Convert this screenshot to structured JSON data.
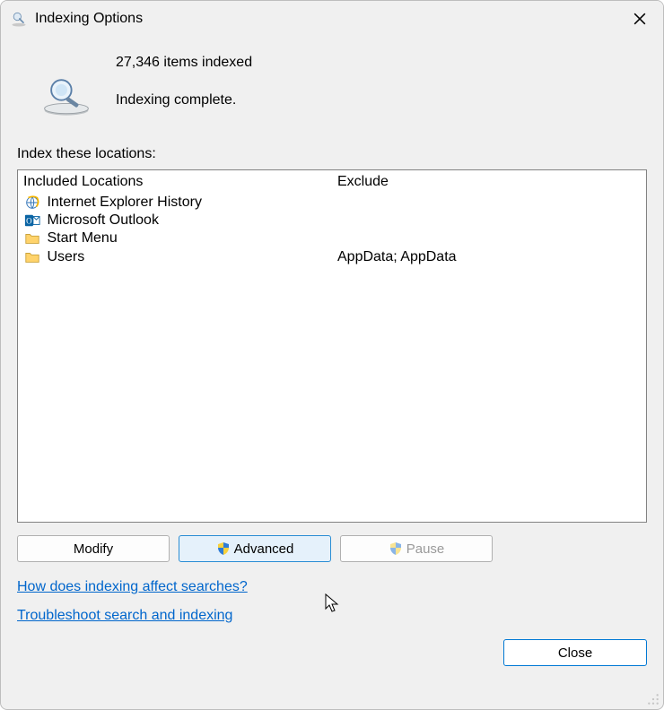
{
  "title": "Indexing Options",
  "status": {
    "count_line": "27,346 items indexed",
    "message": "Indexing complete."
  },
  "section_label": "Index these locations:",
  "columns": {
    "included": "Included Locations",
    "exclude": "Exclude"
  },
  "rows": [
    {
      "icon": "ie",
      "name": "Internet Explorer History",
      "exclude": ""
    },
    {
      "icon": "outlook",
      "name": "Microsoft Outlook",
      "exclude": ""
    },
    {
      "icon": "folder",
      "name": "Start Menu",
      "exclude": ""
    },
    {
      "icon": "folder",
      "name": "Users",
      "exclude": "AppData; AppData"
    }
  ],
  "buttons": {
    "modify": "Modify",
    "advanced": "Advanced",
    "pause": "Pause",
    "close": "Close"
  },
  "links": {
    "help": "How does indexing affect searches?",
    "troubleshoot": "Troubleshoot search and indexing"
  }
}
